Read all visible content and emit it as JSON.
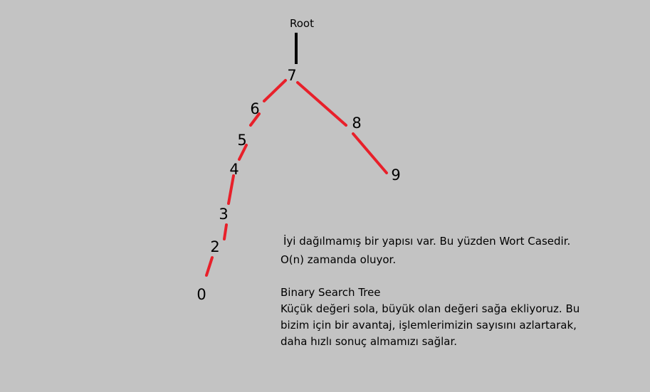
{
  "diagram": {
    "root_label": "Root",
    "nodes": [
      {
        "id": "n7",
        "label": "7"
      },
      {
        "id": "n6",
        "label": "6"
      },
      {
        "id": "n5",
        "label": "5"
      },
      {
        "id": "n4",
        "label": "4"
      },
      {
        "id": "n3",
        "label": "3"
      },
      {
        "id": "n2",
        "label": "2"
      },
      {
        "id": "n0",
        "label": "0"
      },
      {
        "id": "n8",
        "label": "8"
      },
      {
        "id": "n9",
        "label": "9"
      }
    ],
    "edges": [
      {
        "from": "n7",
        "to": "n6"
      },
      {
        "from": "n6",
        "to": "n5"
      },
      {
        "from": "n5",
        "to": "n4"
      },
      {
        "from": "n4",
        "to": "n3"
      },
      {
        "from": "n3",
        "to": "n2"
      },
      {
        "from": "n2",
        "to": "n0"
      },
      {
        "from": "n7",
        "to": "n8"
      },
      {
        "from": "n8",
        "to": "n9"
      }
    ],
    "root_edge_color": "#000000",
    "edge_color": "#e8202a"
  },
  "notes": {
    "line1": " İyi dağılmamış bir yapısı var. Bu yüzden Wort Casedir.",
    "line2": "O(n) zamanda oluyor.",
    "bst_title": "Binary Search Tree",
    "bst_line1": "Küçük değeri sola, büyük olan değeri sağa ekliyoruz. Bu",
    "bst_line2": "bizim için bir avantaj, işlemlerimizin sayısını azlartarak,",
    "bst_line3": "daha hızlı sonuç almamızı sağlar."
  }
}
